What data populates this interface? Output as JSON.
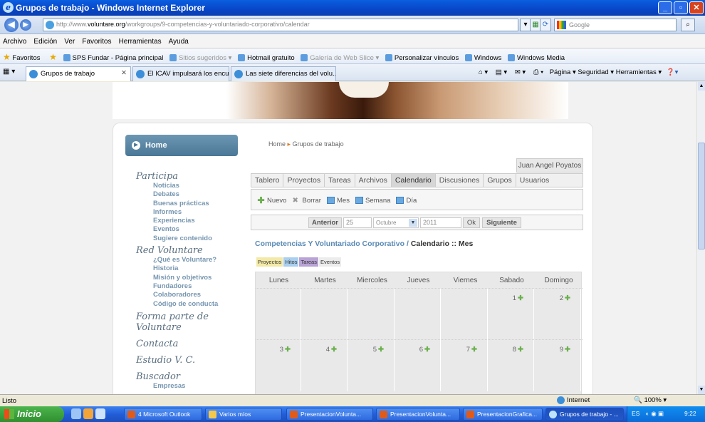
{
  "window": {
    "title": "Grupos de trabajo - Windows Internet Explorer",
    "ie_glyph": "e"
  },
  "address": {
    "url_prefix": "http://www.",
    "url_domain": "voluntare.org",
    "url_path": "/workgroups/9-competencias-y-voluntariado-corporativo/calendar",
    "search_placeholder": "Google"
  },
  "menu": [
    "Archivo",
    "Edición",
    "Ver",
    "Favoritos",
    "Herramientas",
    "Ayuda"
  ],
  "favorites": {
    "label": "Favoritos",
    "items": [
      "SPS Fundar - Página principal",
      "Sitios sugeridos ▾",
      "Hotmail gratuito",
      "Galería de Web Slice ▾",
      "Personalizar vínculos",
      "Windows",
      "Windows Media"
    ]
  },
  "tabs": [
    {
      "label": "Grupos de trabajo"
    },
    {
      "label": "El ICAV impulsará los encuen..."
    },
    {
      "label": "Las siete diferencias del volu..."
    }
  ],
  "tab_tools": "Página ▾   Seguridad ▾   Herramientas ▾",
  "site": {
    "home_label": "Home",
    "sidebar": [
      {
        "title": "Participa",
        "items": [
          "Noticias",
          "Debates",
          "Buenas prácticas",
          "Informes",
          "Experiencias",
          "Eventos",
          "Sugiere contenido"
        ]
      },
      {
        "title": "Red Voluntare",
        "items": [
          "¿Qué es Voluntare?",
          "Historia",
          "Misión y objetivos",
          "Fundadores",
          "Colaboradores",
          "Código de conducta"
        ]
      },
      {
        "title": "Forma parte de Voluntare",
        "items": []
      },
      {
        "title": "Contacta",
        "items": []
      },
      {
        "title": "Estudio V. C.",
        "items": []
      },
      {
        "title": "Buscador",
        "items": [
          "Empresas"
        ]
      }
    ],
    "breadcrumb": {
      "home": "Home",
      "current": "Grupos de trabajo",
      "sep": "▸"
    },
    "user": "Juan Angel Poyatos",
    "tabs": [
      "Tablero",
      "Proyectos",
      "Tareas",
      "Archivos",
      "Calendario",
      "Discusiones",
      "Grupos",
      "Usuarios"
    ],
    "toolbar": {
      "nuevo": "Nuevo",
      "borrar": "Borrar",
      "mes": "Mes",
      "semana": "Semana",
      "dia": "Día"
    },
    "nav": {
      "anterior": "Anterior",
      "day": "25",
      "month": "Octubre",
      "year": "2011",
      "ok": "Ok",
      "siguiente": "Siguiente"
    },
    "calendar_title": {
      "group": "Competencias Y Voluntariado Corporativo",
      "sep": " / ",
      "view": "Calendario :: Mes"
    },
    "legend": [
      {
        "label": "Proyectos",
        "color": "#f3e9a6"
      },
      {
        "label": "Hitos",
        "color": "#a8cfee"
      },
      {
        "label": "Tareas",
        "color": "#b9a3d6"
      },
      {
        "label": "Eventos",
        "color": "#ececec"
      }
    ],
    "weekdays": [
      "Lunes",
      "Martes",
      "Miercoles",
      "Jueves",
      "Viernes",
      "Sabado",
      "Domingo"
    ],
    "week1": [
      "",
      "",
      "",
      "",
      "",
      "1",
      "2"
    ],
    "week2": [
      "3",
      "4",
      "5",
      "6",
      "7",
      "8",
      "9"
    ]
  },
  "status": {
    "text": "Listo",
    "zone": "Internet",
    "zoom": "100%"
  },
  "taskbar": {
    "start": "Inicio",
    "buttons": [
      "4 Microsoft Outlook",
      "Varios míos",
      "PresentacionVolunta...",
      "PresentacionVolunta...",
      "PresentacionGrafica...",
      "Grupos de trabajo - ..."
    ],
    "lang": "ES",
    "clock": "9:22"
  }
}
